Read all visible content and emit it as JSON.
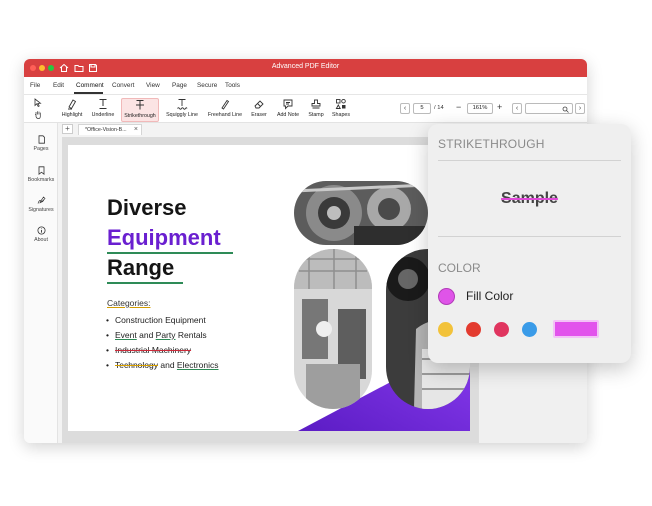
{
  "window": {
    "title": "Advanced PDF Editor"
  },
  "menu": [
    {
      "label": "File"
    },
    {
      "label": "Edit"
    },
    {
      "label": "Comment"
    },
    {
      "label": "Convert"
    },
    {
      "label": "View"
    },
    {
      "label": "Page"
    },
    {
      "label": "Secure"
    },
    {
      "label": "Tools"
    }
  ],
  "menu_active": "Comment",
  "tools": [
    {
      "label": "Highlight",
      "icon": "highlighter-icon"
    },
    {
      "label": "Underline",
      "icon": "underline-icon"
    },
    {
      "label": "Strikethrough",
      "icon": "strikethrough-icon",
      "selected": true
    },
    {
      "label": "Squiggly Line",
      "icon": "squiggly-icon"
    },
    {
      "label": "Freehand Line",
      "icon": "pen-icon"
    },
    {
      "label": "Eraser",
      "icon": "eraser-icon"
    },
    {
      "label": "Add Note",
      "icon": "note-icon"
    },
    {
      "label": "Stamp",
      "icon": "stamp-icon"
    },
    {
      "label": "Shapes",
      "icon": "shapes-icon"
    }
  ],
  "pagination": {
    "current": "5",
    "total": "/ 14"
  },
  "zoom": {
    "value": "161%",
    "minus": "−",
    "plus": "+"
  },
  "sidebar": [
    {
      "label": "Pages",
      "icon": "pages-icon"
    },
    {
      "label": "Bookmarks",
      "icon": "bookmark-icon"
    },
    {
      "label": "Signatures",
      "icon": "signature-icon"
    },
    {
      "label": "About",
      "icon": "info-icon"
    }
  ],
  "tab": {
    "add": "+",
    "name": "*Office-Vision-B...",
    "close": "×"
  },
  "slide": {
    "line1": "Diverse",
    "line2": "Equipment",
    "line3": "Range",
    "categories_label": "Categories:",
    "bullets": {
      "b1": "Construction Equipment",
      "b2_a": "Event",
      "b2_b": " and ",
      "b2_c": "Party",
      "b2_d": " Rentals",
      "b3": "Industrial Machinery",
      "b4_a": "Technology",
      "b4_b": " and ",
      "b4_c": "Electronics"
    },
    "accent_color": "#6a1fd0"
  },
  "popover": {
    "title": "STRIKETHROUGH",
    "sample": "Sample",
    "color_title": "COLOR",
    "fill_label": "Fill Color",
    "fill_color": "#df54e8",
    "swatches": [
      "#f2c23a",
      "#e33b2f",
      "#e0355f",
      "#3a9be8"
    ],
    "selected_color": "#e253ec"
  }
}
